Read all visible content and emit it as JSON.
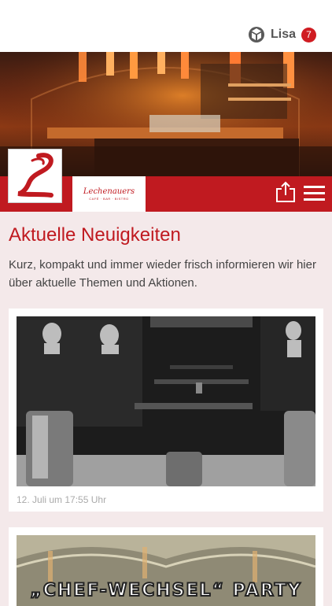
{
  "header": {
    "user_icon": "cube-user-icon",
    "user_name": "Lisa",
    "notification_count": "7"
  },
  "hero": {
    "image": "restaurant-bar-interior"
  },
  "branding": {
    "logo_icon": "script-L-logo",
    "brand_name": "Lechenauers",
    "brand_tagline": "CAFÉ · BAR · BISTRO"
  },
  "toolbar": {
    "share_icon": "share-icon",
    "menu_icon": "hamburger-menu-icon"
  },
  "page": {
    "title": "Aktuelle Neuigkeiten",
    "intro": "Kurz, kompakt und immer wieder frisch informieren wir hier über aktuelle Themen und Aktionen."
  },
  "news": [
    {
      "image": "black-white-restaurant-photo",
      "date": "12. Juli um 17:55 Uhr"
    },
    {
      "image": "party-vault-photo",
      "headline": "„CHEF-WECHSEL“ PARTY"
    }
  ],
  "colors": {
    "accent": "#c01a20",
    "background": "#f4e9ea",
    "badge": "#d01c22"
  }
}
